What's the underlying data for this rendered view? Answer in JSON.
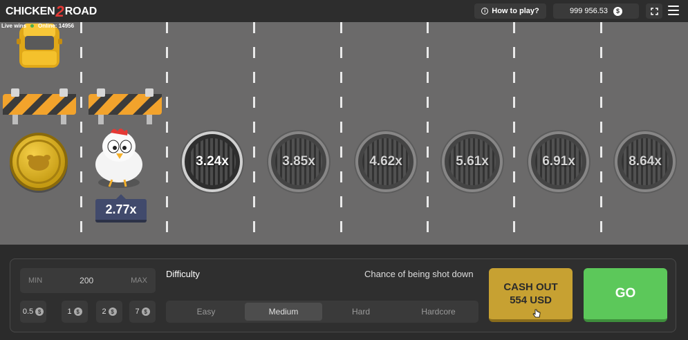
{
  "header": {
    "logo_left": "CHICKEN",
    "logo_number": "2",
    "logo_right": "ROAD",
    "live_wins": "Live wins",
    "online": "Online: 14956",
    "how_to_play": "How to play?",
    "balance": "999 956.53",
    "currency_symbol": "$"
  },
  "road": {
    "current_multiplier": "2.77x",
    "multipliers": [
      "3.24x",
      "3.85x",
      "4.62x",
      "5.61x",
      "6.91x",
      "8.64x"
    ]
  },
  "controls": {
    "bet": {
      "min_label": "MIN",
      "value": "200",
      "max_label": "MAX"
    },
    "quick_bets": [
      "0.5",
      "1",
      "2",
      "7"
    ],
    "difficulty_label": "Difficulty",
    "chance_label": "Chance of being shot down",
    "difficulties": [
      "Easy",
      "Medium",
      "Hard",
      "Hardcore"
    ],
    "selected_difficulty": "Medium",
    "cash_out_line1": "CASH OUT",
    "cash_out_line2": "554 USD",
    "go_label": "GO"
  },
  "colors": {
    "road": "#6b6a6a",
    "cash_out": "#c7a132",
    "go": "#5cc85a",
    "multiplier_badge": "#414a6c"
  }
}
